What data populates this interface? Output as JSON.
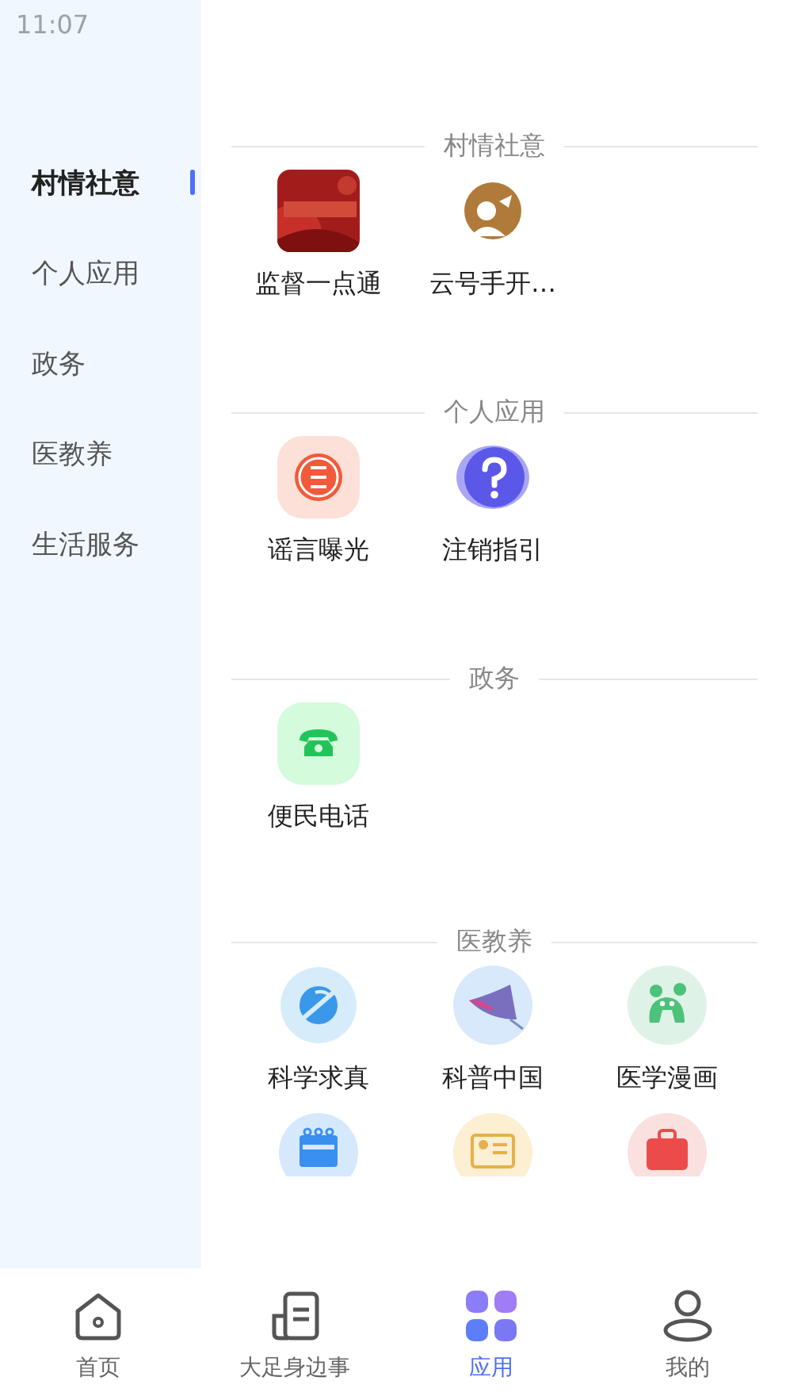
{
  "status_bar": {
    "time": "11:07"
  },
  "sidebar": {
    "items": [
      {
        "label": "村情社意",
        "selected": true
      },
      {
        "label": "个人应用",
        "selected": false
      },
      {
        "label": "政务",
        "selected": false
      },
      {
        "label": "医教养",
        "selected": false
      },
      {
        "label": "生活服务",
        "selected": false
      }
    ]
  },
  "sections": [
    {
      "title": "村情社意",
      "items": [
        {
          "kind": "app",
          "label": "监督一点通"
        },
        {
          "kind": "app",
          "label": "云号手开…"
        }
      ]
    },
    {
      "title": "个人应用",
      "items": [
        {
          "kind": "app",
          "label": "谣言曝光"
        },
        {
          "kind": "app",
          "label": "注销指引"
        }
      ]
    },
    {
      "title": "政务",
      "items": [
        {
          "kind": "app",
          "label": "便民电话"
        }
      ]
    },
    {
      "title": "医教养",
      "items": [
        {
          "kind": "app",
          "label": "科学求真"
        },
        {
          "kind": "app",
          "label": "科普中国"
        },
        {
          "kind": "app",
          "label": "医学漫画"
        },
        {
          "kind": "cut"
        },
        {
          "kind": "cut"
        },
        {
          "kind": "cut"
        }
      ]
    }
  ],
  "tab_bar": {
    "tabs": [
      {
        "label": "首页",
        "selected": false
      },
      {
        "label": "大足身边事",
        "selected": false
      },
      {
        "label": "应用",
        "selected": true
      },
      {
        "label": "我的",
        "selected": false
      }
    ]
  }
}
